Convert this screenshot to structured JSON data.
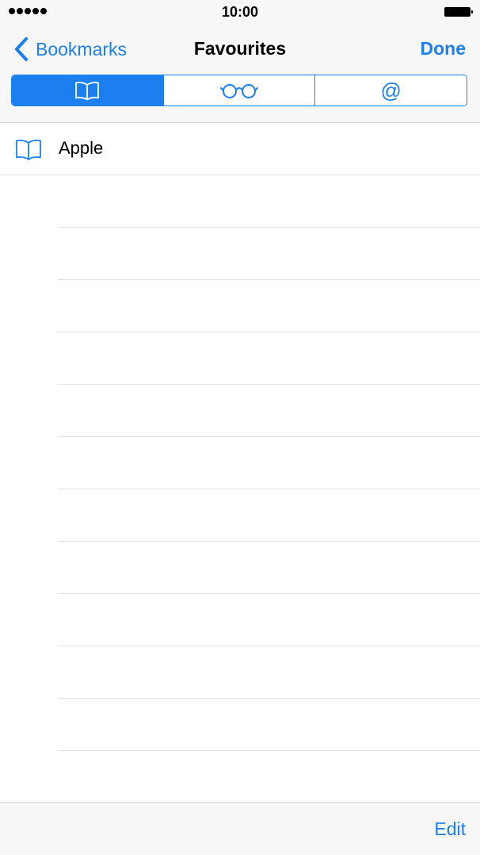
{
  "status_bar": {
    "time": "10:00",
    "signal_icon": "signal-dots-icon",
    "battery_icon": "battery-full-icon"
  },
  "nav": {
    "back_label": "Bookmarks",
    "title": "Favourites",
    "done_label": "Done"
  },
  "segments": [
    {
      "icon": "book-icon",
      "selected": true
    },
    {
      "icon": "glasses-icon",
      "selected": false
    },
    {
      "icon": "at-icon",
      "label": "@",
      "selected": false
    }
  ],
  "bookmarks": [
    {
      "label": "Apple",
      "icon": "book-icon"
    }
  ],
  "toolbar": {
    "edit_label": "Edit"
  },
  "colors": {
    "accent": "#1c7ff0",
    "bar_background": "#f7f7f7",
    "separator": "#e2e2e6"
  }
}
